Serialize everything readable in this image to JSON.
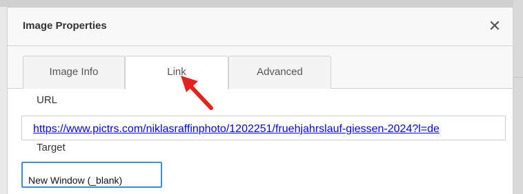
{
  "dialog": {
    "title": "Image Properties",
    "close_icon": "close-icon",
    "close_glyph": "✕"
  },
  "tabs": [
    {
      "label": "Image Info",
      "active": false
    },
    {
      "label": "Link",
      "active": true
    },
    {
      "label": "Advanced",
      "active": false
    }
  ],
  "link": {
    "url_label": "URL",
    "url_value": "https://www.pictrs.com/niklasraffinphoto/1202251/fruehjahrslauf-giessen-2024?l=de",
    "target_label": "Target",
    "target_value": "New Window (_blank)"
  },
  "annotation": {
    "arrow_icon": "red-arrow-icon",
    "arrow_color": "#e8201a"
  },
  "colors": {
    "link": "#0000ee",
    "focus_border": "#3b8fd9",
    "header_bg": "#f8f8f8"
  }
}
